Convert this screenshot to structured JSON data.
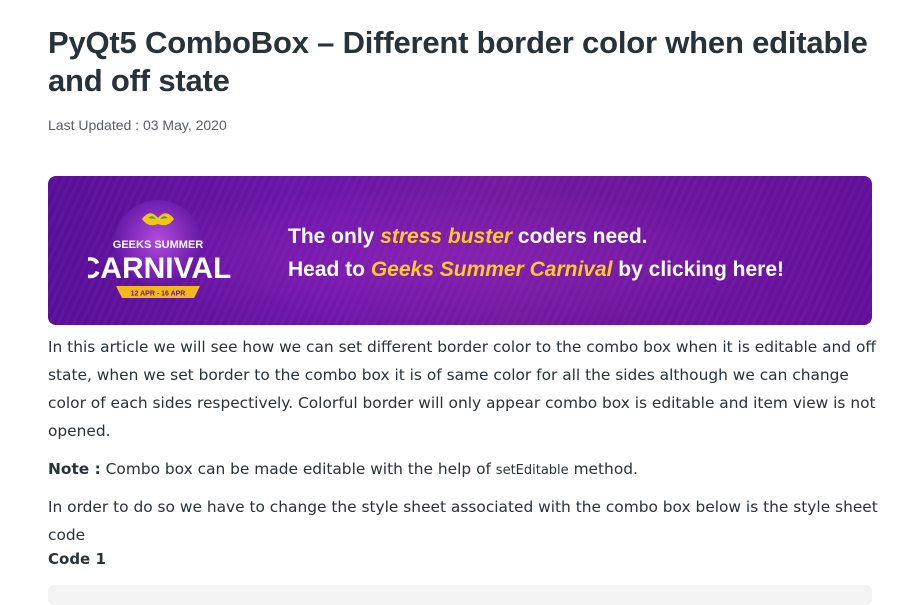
{
  "article": {
    "title": "PyQt5 ComboBox – Different border color when editable and off state",
    "last_updated": "Last Updated : 03 May, 2020"
  },
  "banner": {
    "badge_line1": "GEEKS SUMMER",
    "badge_line2": "CARNIVAL",
    "badge_dates": "12 APR - 16 APR",
    "line1_pre": "The only ",
    "line1_highlight": "stress buster",
    "line1_post": " coders need.",
    "line2_pre": "Head to ",
    "line2_highlight": "Geeks Summer Carnival",
    "line2_post": " by clicking here!",
    "colors": {
      "bg": "#6a15a8",
      "highlight": "#ffc928",
      "text": "#ffffff"
    }
  },
  "body": {
    "p1": "In this article we will see how we can set different border color to the combo box when it is editable and off state, when we set border to the combo box it is of same color for all the sides although we can change color of each sides respectively. Colorful border will only appear combo box is editable and item view is not opened.",
    "note_label": "Note :",
    "note_text_pre": " Combo box can be made editable with the help of ",
    "note_code": "setEditable",
    "note_text_post": " method.",
    "p3": "In order to do so we have to change the style sheet associated with the combo box below is the style sheet code",
    "code_label": "Code 1"
  }
}
